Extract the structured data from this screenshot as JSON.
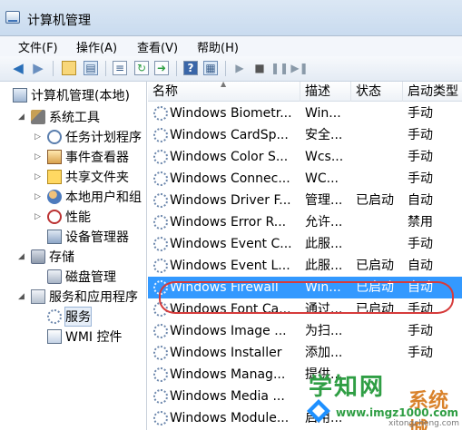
{
  "window": {
    "title": "计算机管理"
  },
  "menus": [
    "文件(F)",
    "操作(A)",
    "查看(V)",
    "帮助(H)"
  ],
  "toolbar": {
    "icons": [
      "back-arrow-icon",
      "forward-arrow-icon",
      "up-folder-icon",
      "show-hide-tree-icon",
      "properties-icon",
      "refresh-icon",
      "export-list-icon",
      "help-icon",
      "view-icon",
      "play-icon",
      "stop-icon",
      "pause-icon",
      "restart-icon"
    ]
  },
  "tree": [
    {
      "label": "计算机管理(本地)",
      "icon": "computer-icon"
    },
    {
      "label": "系统工具",
      "icon": "tools-icon",
      "expander": "◢"
    },
    {
      "label": "任务计划程序",
      "icon": "clock-icon",
      "expander": "▷"
    },
    {
      "label": "事件查看器",
      "icon": "event-log-icon",
      "expander": "▷"
    },
    {
      "label": "共享文件夹",
      "icon": "shared-folder-icon",
      "expander": "▷"
    },
    {
      "label": "本地用户和组",
      "icon": "users-icon",
      "expander": "▷"
    },
    {
      "label": "性能",
      "icon": "performance-icon",
      "expander": "▷"
    },
    {
      "label": "设备管理器",
      "icon": "device-manager-icon"
    },
    {
      "label": "存储",
      "icon": "storage-icon",
      "expander": "◢"
    },
    {
      "label": "磁盘管理",
      "icon": "disk-icon"
    },
    {
      "label": "服务和应用程序",
      "icon": "services-apps-icon",
      "expander": "◢"
    },
    {
      "label": "服务",
      "icon": "gear-icon"
    },
    {
      "label": "WMI 控件",
      "icon": "wmi-icon"
    }
  ],
  "columns": {
    "name": "名称",
    "desc": "描述",
    "status": "状态",
    "startup": "启动类型"
  },
  "services": [
    {
      "name": "Windows Biometr...",
      "desc": "Win...",
      "status": "",
      "startup": "手动"
    },
    {
      "name": "Windows CardSp...",
      "desc": "安全...",
      "status": "",
      "startup": "手动"
    },
    {
      "name": "Windows Color S...",
      "desc": "Wcs...",
      "status": "",
      "startup": "手动"
    },
    {
      "name": "Windows Connec...",
      "desc": "WC...",
      "status": "",
      "startup": "手动"
    },
    {
      "name": "Windows Driver F...",
      "desc": "管理...",
      "status": "已启动",
      "startup": "自动"
    },
    {
      "name": "Windows Error R...",
      "desc": "允许...",
      "status": "",
      "startup": "禁用"
    },
    {
      "name": "Windows Event C...",
      "desc": "此服...",
      "status": "",
      "startup": "手动"
    },
    {
      "name": "Windows Event L...",
      "desc": "此服...",
      "status": "已启动",
      "startup": "自动"
    },
    {
      "name": "Windows Firewall",
      "desc": "Win...",
      "status": "已启动",
      "startup": "自动"
    },
    {
      "name": "Windows Font Ca...",
      "desc": "通过...",
      "status": "已启动",
      "startup": "手动"
    },
    {
      "name": "Windows Image ...",
      "desc": "为扫...",
      "status": "",
      "startup": "手动"
    },
    {
      "name": "Windows Installer",
      "desc": "添加...",
      "status": "",
      "startup": "手动"
    },
    {
      "name": "Windows Manag...",
      "desc": "提供...",
      "status": "",
      "startup": ""
    },
    {
      "name": "Windows Media ...",
      "desc": "",
      "status": "",
      "startup": ""
    },
    {
      "name": "Windows Module...",
      "desc": "启用...",
      "status": "",
      "startup": ""
    }
  ],
  "watermark": {
    "main": "学知网",
    "side": "系统城",
    "url": "www.imgz1000.com",
    "sub": "xitongcheng.com"
  },
  "colors": {
    "selection": "#3399ff",
    "highlight_ring": "#d63b3b",
    "watermark_green": "#2f9e44",
    "watermark_orange": "#d9822b"
  }
}
